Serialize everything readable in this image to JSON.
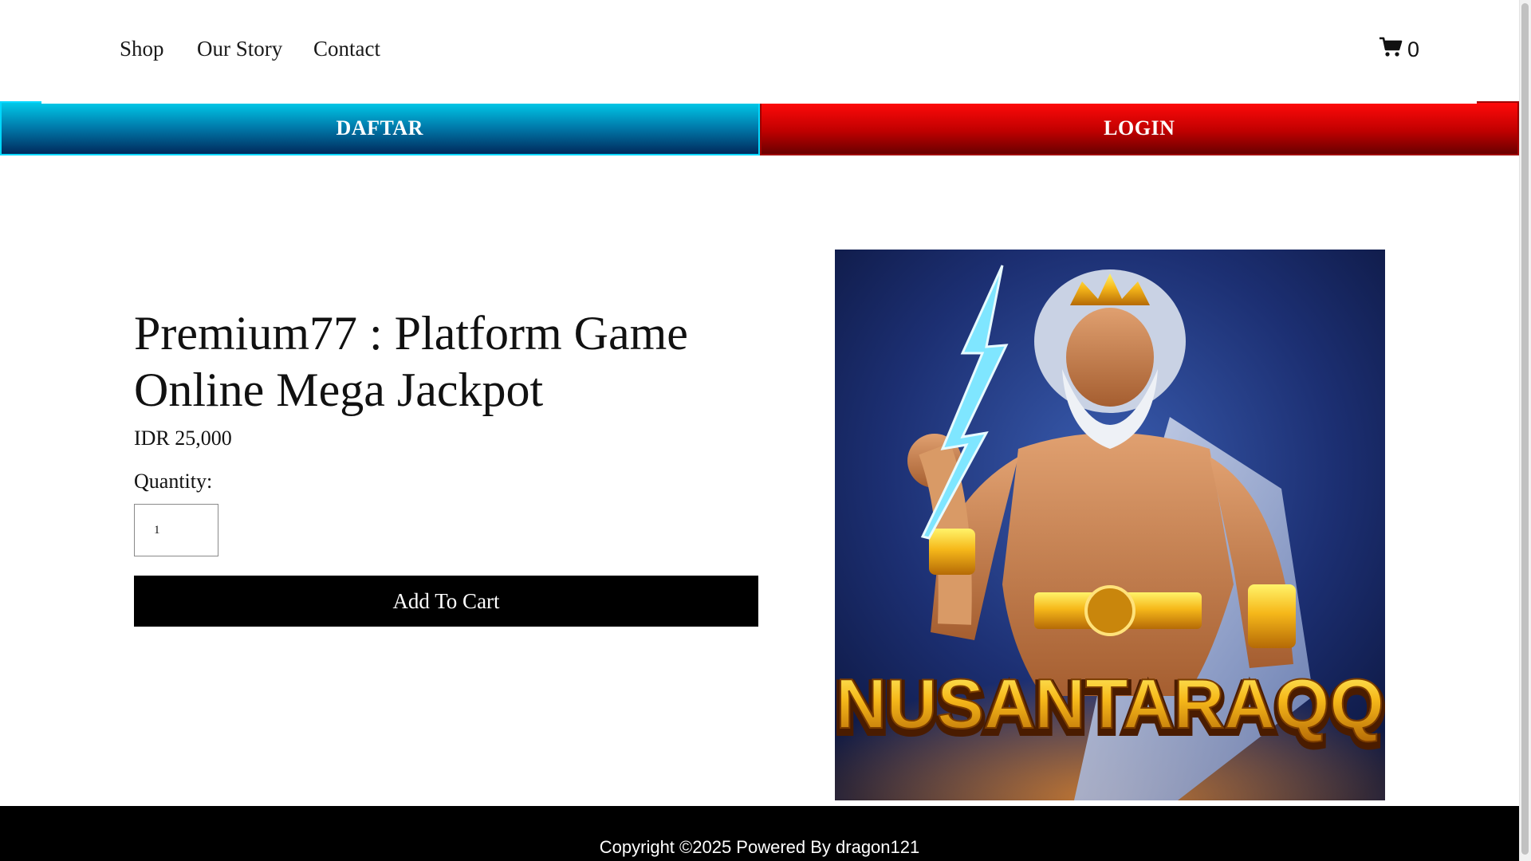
{
  "nav": {
    "links": [
      "Shop",
      "Our Story",
      "Contact"
    ],
    "cart_count": "0"
  },
  "cta": {
    "daftar_label": "DAFTAR",
    "login_label": "LOGIN"
  },
  "product": {
    "title": "Premium77 : Platform Game Online Mega Jackpot",
    "price": "IDR 25,000",
    "quantity_label": "Quantity:",
    "quantity_value": "1",
    "add_to_cart_label": "Add To Cart",
    "image_caption": "NUSANTARAQQ"
  },
  "footer": {
    "copyright": "Copyright ©2025 Powered By dragon121"
  },
  "colors": {
    "daftar_top": "#00c8e8",
    "daftar_bottom": "#002a5c",
    "login_top": "#ff0a0a",
    "login_bottom": "#6a0000",
    "button_bg": "#000000",
    "footer_bg": "#000000"
  }
}
